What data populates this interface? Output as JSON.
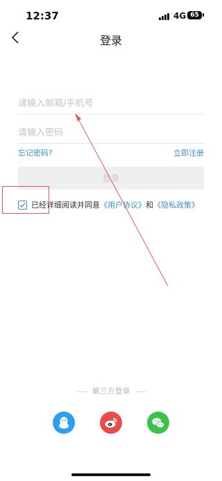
{
  "status": {
    "time": "12:37",
    "network": "4G",
    "battery": "65"
  },
  "nav": {
    "title": "登录"
  },
  "form": {
    "email_placeholder": "请输入邮箱/手机号",
    "password_placeholder": "请输入密码",
    "forgot_label": "忘记密码?",
    "register_label": "立即注册",
    "login_label": "登录"
  },
  "agreement": {
    "checked": true,
    "prefix": "已经详细阅读并同意",
    "user_agreement": "《用户协议》",
    "conjunction": "和",
    "privacy_policy": "《隐私政策》"
  },
  "third_party": {
    "title": "第三方登录",
    "providers": [
      "qq-icon",
      "weibo-icon",
      "wechat-icon"
    ]
  },
  "colors": {
    "link": "#3f8ed0",
    "qq": "#2d9ff1",
    "weibo": "#ea4b4b",
    "wechat": "#3cc24b",
    "annotation": "#e05a5a"
  }
}
